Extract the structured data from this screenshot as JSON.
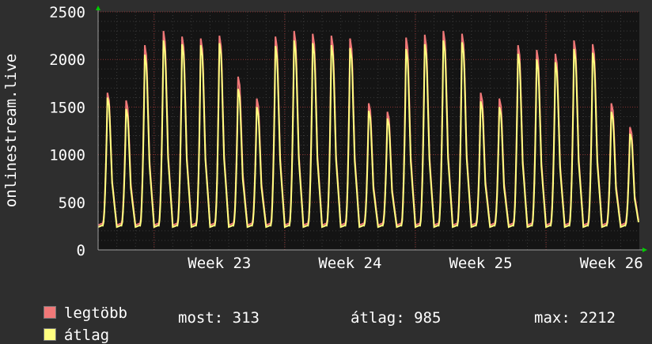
{
  "chart_data": {
    "type": "line",
    "ylabel": "onlinestream.live",
    "y_ticks": [
      "0",
      "500",
      "1000",
      "1500",
      "2000",
      "2500"
    ],
    "ylim": [
      0,
      2500
    ],
    "x_ticks": [
      "Week 23",
      "Week 24",
      "Week 25",
      "Week 26"
    ],
    "grid": true,
    "series": [
      {
        "name": "legtöbb",
        "color": "#f07878",
        "daily_peaks": [
          1650,
          1570,
          2150,
          2300,
          2240,
          2220,
          2250,
          1820,
          1590,
          2240,
          2300,
          2270,
          2250,
          2220,
          1540,
          1450,
          2230,
          2260,
          2300,
          2270,
          1650,
          1590,
          2150,
          2100,
          2060,
          2200,
          2160,
          1540,
          1290
        ]
      },
      {
        "name": "átlag",
        "color": "#ffff80",
        "daily_peaks": [
          1600,
          1480,
          2050,
          2200,
          2160,
          2150,
          2170,
          1690,
          1500,
          2140,
          2200,
          2170,
          2150,
          2120,
          1460,
          1380,
          2110,
          2160,
          2200,
          2180,
          1560,
          1500,
          2060,
          2000,
          1970,
          2110,
          2070,
          1450,
          1220
        ]
      }
    ]
  },
  "legend": [
    {
      "label": "legtöbb",
      "color": "#f07878"
    },
    {
      "label": "átlag",
      "color": "#ffff80"
    }
  ],
  "stats": {
    "current": "most: 313",
    "average": "átlag: 985",
    "max": "max: 2212"
  }
}
